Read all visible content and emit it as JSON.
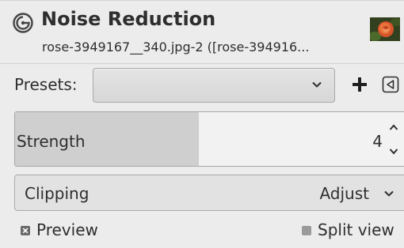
{
  "header": {
    "title": "Noise Reduction",
    "subtitle": "rose-3949167__340.jpg-2 ([rose-394916...",
    "icon": "gimp-swirl-icon",
    "thumbnail": "rose-thumbnail"
  },
  "presets": {
    "label": "Presets:",
    "value": "",
    "add_icon": "plus-icon",
    "menu_icon": "triangle-left-menu-icon"
  },
  "strength": {
    "label": "Strength",
    "value": "4",
    "fill_fraction": 0.47
  },
  "clipping": {
    "label": "Clipping",
    "value": "Adjust"
  },
  "preview": {
    "label": "Preview",
    "checked": true
  },
  "split_view": {
    "label": "Split view",
    "checked": false
  },
  "colors": {
    "background": "#ececec",
    "text": "#2e2e2e",
    "border": "#a9a9a9",
    "slider_fill": "#cfcfcf"
  }
}
